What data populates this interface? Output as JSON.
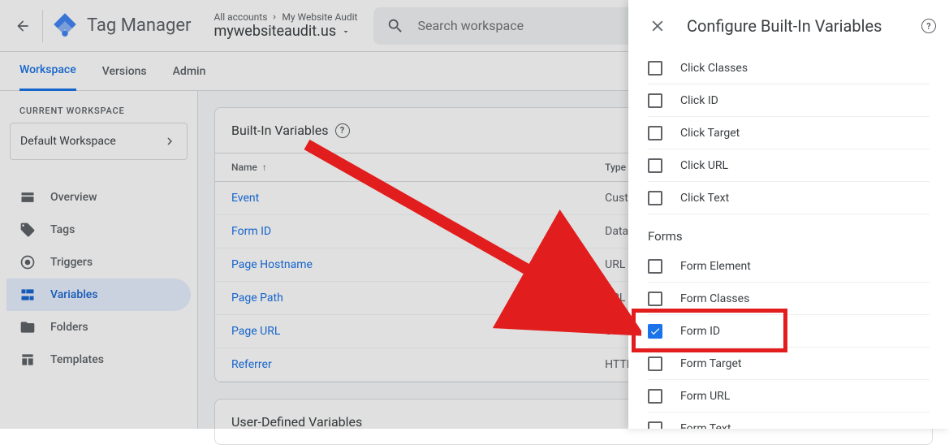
{
  "header": {
    "title": "Tag Manager",
    "breadcrumb": [
      "All accounts",
      "My Website Audit"
    ],
    "account": "mywebsiteaudit.us",
    "searchPlaceholder": "Search workspace"
  },
  "tabs": [
    "Workspace",
    "Versions",
    "Admin"
  ],
  "activeTab": 0,
  "sidebar": {
    "wsLabel": "CURRENT WORKSPACE",
    "wsName": "Default Workspace",
    "items": [
      {
        "label": "Overview",
        "icon": "box"
      },
      {
        "label": "Tags",
        "icon": "tag"
      },
      {
        "label": "Triggers",
        "icon": "target"
      },
      {
        "label": "Variables",
        "icon": "brick",
        "active": true
      },
      {
        "label": "Folders",
        "icon": "folder"
      },
      {
        "label": "Templates",
        "icon": "template"
      }
    ]
  },
  "content": {
    "card1Title": "Built-In Variables",
    "columns": [
      "Name",
      "Type"
    ],
    "rows": [
      {
        "name": "Event",
        "type": "Custom Event"
      },
      {
        "name": "Form ID",
        "type": "Data Layer"
      },
      {
        "name": "Page Hostname",
        "type": "URL"
      },
      {
        "name": "Page Path",
        "type": "URL"
      },
      {
        "name": "Page URL",
        "type": "URL"
      },
      {
        "name": "Referrer",
        "type": "HTTP Referrer"
      }
    ],
    "card2Title": "User-Defined Variables"
  },
  "panel": {
    "title": "Configure Built-In Variables",
    "sections": [
      {
        "heading": null,
        "items": [
          {
            "label": "Click Classes",
            "checked": false
          },
          {
            "label": "Click ID",
            "checked": false
          },
          {
            "label": "Click Target",
            "checked": false
          },
          {
            "label": "Click URL",
            "checked": false
          },
          {
            "label": "Click Text",
            "checked": false
          }
        ]
      },
      {
        "heading": "Forms",
        "items": [
          {
            "label": "Form Element",
            "checked": false
          },
          {
            "label": "Form Classes",
            "checked": false
          },
          {
            "label": "Form ID",
            "checked": true
          },
          {
            "label": "Form Target",
            "checked": false
          },
          {
            "label": "Form URL",
            "checked": false
          },
          {
            "label": "Form Text",
            "checked": false
          }
        ]
      }
    ]
  }
}
